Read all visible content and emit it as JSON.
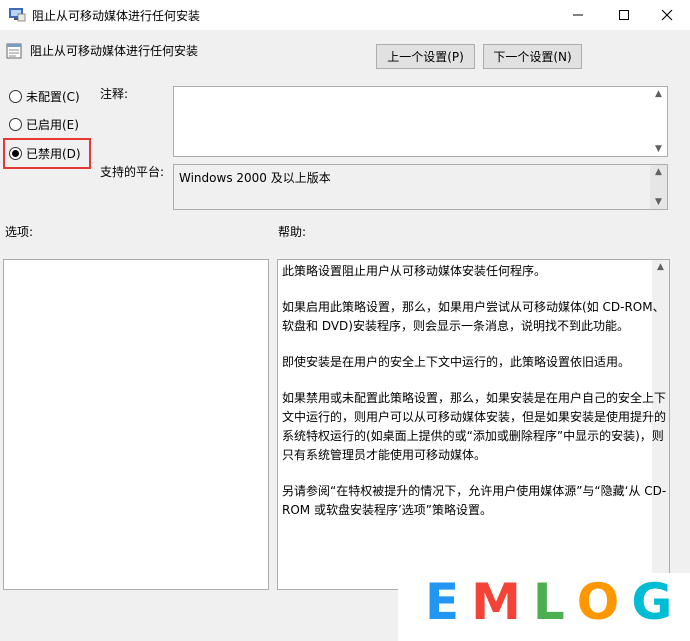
{
  "window": {
    "title": "阻止从可移动媒体进行任何安装"
  },
  "header": {
    "title": "阻止从可移动媒体进行任何安装",
    "prev_button": "上一个设置(P)",
    "next_button": "下一个设置(N)"
  },
  "radios": [
    {
      "label": "未配置(C)",
      "checked": false
    },
    {
      "label": "已启用(E)",
      "checked": false
    },
    {
      "label": "已禁用(D)",
      "checked": true
    }
  ],
  "comment": {
    "label": "注释:",
    "value": ""
  },
  "platform": {
    "label": "支持的平台:",
    "value": "Windows 2000 及以上版本"
  },
  "options": {
    "label": "选项:"
  },
  "help": {
    "label": "帮助:",
    "paragraphs": [
      "此策略设置阻止用户从可移动媒体安装任何程序。",
      "如果启用此策略设置，那么，如果用户尝试从可移动媒体(如 CD-ROM、软盘和 DVD)安装程序，则会显示一条消息，说明找不到此功能。",
      "即使安装是在用户的安全上下文中运行的，此策略设置依旧适用。",
      "如果禁用或未配置此策略设置，那么，如果安装是在用户自己的安全上下文中运行的，则用户可以从可移动媒体安装，但是如果安装是使用提升的系统特权运行的(如桌面上提供的或“添加或删除程序”中显示的安装)，则只有系统管理员才能使用可移动媒体。",
      "另请参阅“在特权被提升的情况下，允许用户使用媒体源”与“隐藏‘从 CD-ROM 或软盘安装程序’选项”策略设置。"
    ]
  },
  "logo": {
    "letters": [
      "E",
      "M",
      "L",
      "O",
      "G"
    ],
    "colors": [
      "#2196f3",
      "#f44336",
      "#4caf50",
      "#ff9800",
      "#00bcd4"
    ]
  }
}
